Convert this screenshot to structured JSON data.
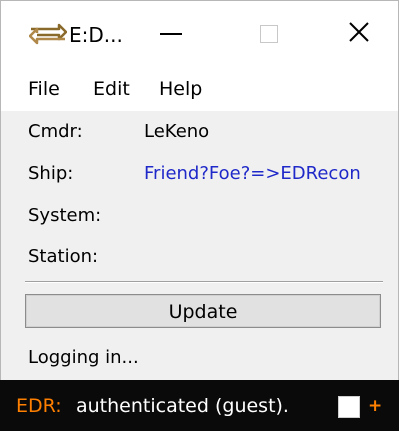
{
  "window": {
    "title": "E:D..."
  },
  "menu": {
    "items": [
      "File",
      "Edit",
      "Help"
    ]
  },
  "info": {
    "rows": [
      {
        "label": "Cmdr:",
        "value": "LeKeno"
      },
      {
        "label": "Ship:",
        "value": "Friend?Foe?=>EDRecon"
      },
      {
        "label": "System:",
        "value": ""
      },
      {
        "label": "Station:",
        "value": ""
      }
    ]
  },
  "actions": {
    "update_label": "Update"
  },
  "status": {
    "text": "Logging in..."
  },
  "overlay": {
    "tag": "EDR:",
    "message": "authenticated (guest).",
    "plus": "+"
  },
  "colors": {
    "link": "#1f28c8",
    "accent": "#ff8000",
    "overlay_bg": "#0a0a0a"
  },
  "icons": {
    "app": "arrows-exchange-icon",
    "minimize": "minimize-icon",
    "maximize": "maximize-icon",
    "close": "close-icon"
  }
}
